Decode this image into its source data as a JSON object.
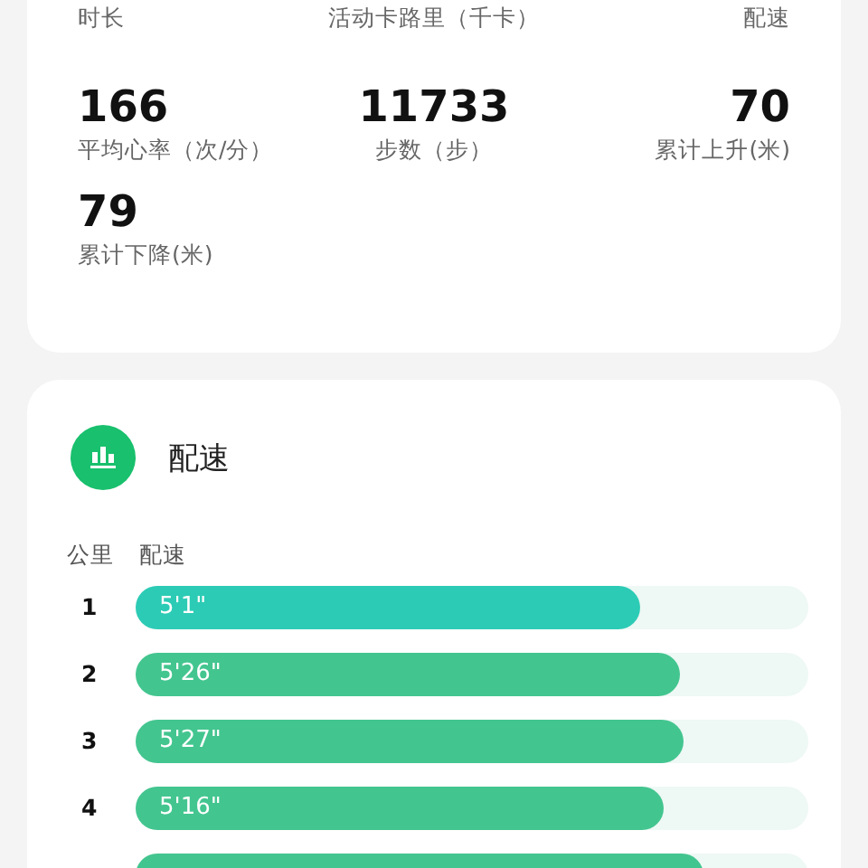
{
  "summary_card": {
    "header_labels": [
      "时长",
      "活动卡路里（千卡）",
      "配速"
    ],
    "stats": [
      {
        "value": "166",
        "label": "平均心率（次/分）"
      },
      {
        "value": "11733",
        "label": "步数（步）"
      },
      {
        "value": "70",
        "label": "累计上升(米)"
      },
      {
        "value": "79",
        "label": "累计下降(米)"
      }
    ]
  },
  "pace_card": {
    "title": "配速",
    "columns": [
      "公里",
      "配速"
    ],
    "rows": [
      {
        "km": "1",
        "pace": "5'1\"",
        "level": 0.75,
        "color": "#2ccbb5"
      },
      {
        "km": "2",
        "pace": "5'26\"",
        "level": 0.81,
        "color": "#43c58f"
      },
      {
        "km": "3",
        "pace": "5'27\"",
        "level": 0.815,
        "color": "#43c58f"
      },
      {
        "km": "4",
        "pace": "5'16\"",
        "level": 0.785,
        "color": "#43c58f"
      },
      {
        "level": 0.845,
        "color": "#43c58f"
      }
    ]
  }
}
